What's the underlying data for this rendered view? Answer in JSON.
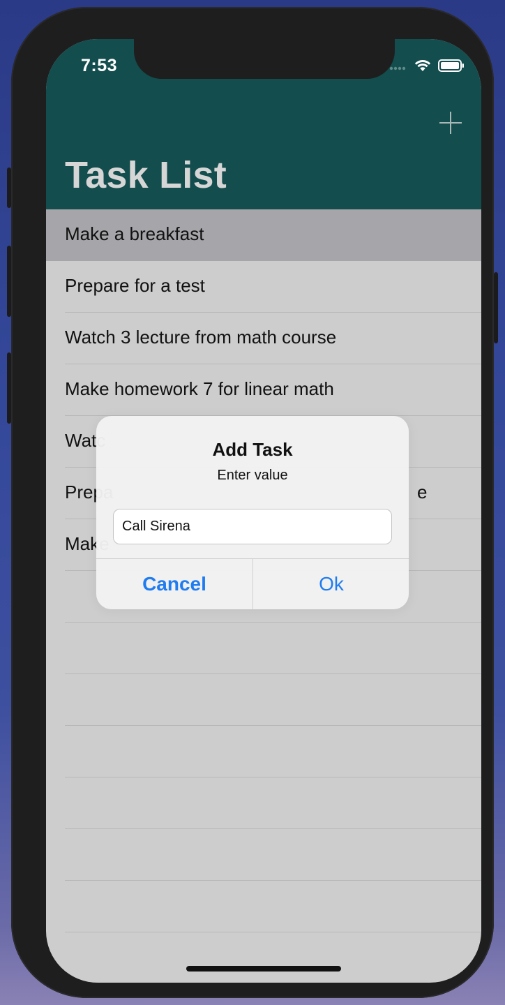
{
  "status_bar": {
    "time": "7:53",
    "icons": [
      "signal-icon",
      "wifi-icon",
      "battery-icon"
    ]
  },
  "navbar": {
    "title": "Task List",
    "add_button_icon": "plus-icon",
    "background_color": "#134d4d"
  },
  "tasks": [
    {
      "label": "Make a breakfast",
      "selected": true
    },
    {
      "label": "Prepare for a test",
      "selected": false
    },
    {
      "label": "Watch 3 lecture from math course",
      "selected": false
    },
    {
      "label": "Make homework 7 for linear math",
      "selected": false
    },
    {
      "label": "Watc",
      "selected": false
    },
    {
      "label": "Prepa",
      "selected": false,
      "trailing": "e"
    },
    {
      "label": "Make",
      "selected": false
    }
  ],
  "alert": {
    "title": "Add Task",
    "message": "Enter value",
    "input_value": "Call Sirena",
    "cancel_label": "Cancel",
    "ok_label": "Ok",
    "accent_color": "#1f7cf0"
  }
}
